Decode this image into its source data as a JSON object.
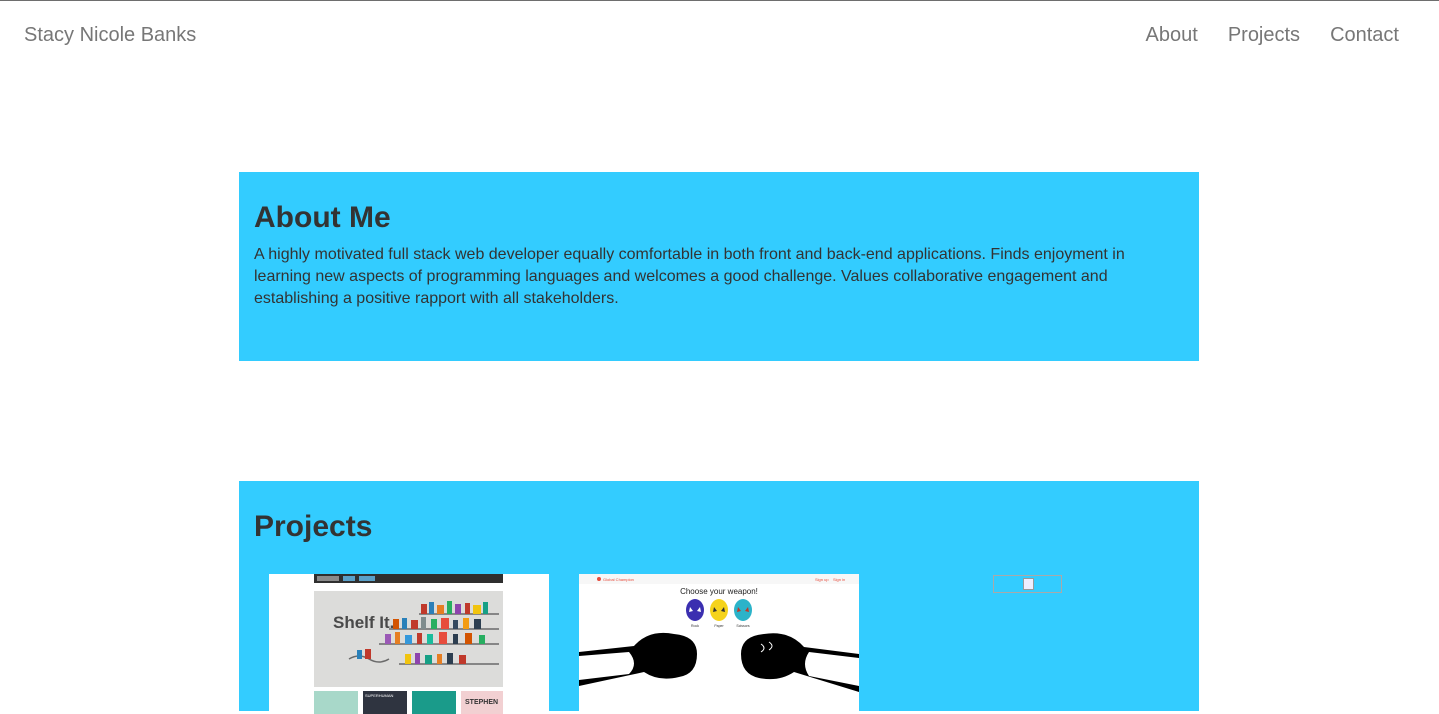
{
  "header": {
    "brand": "Stacy Nicole Banks",
    "nav": [
      {
        "label": "About"
      },
      {
        "label": "Projects"
      },
      {
        "label": "Contact"
      }
    ]
  },
  "about": {
    "title": "About Me",
    "body": "A highly motivated full stack web developer equally comfortable in both front and back-end applications. Finds enjoyment in learning new aspects of programming languages and welcomes a good challenge. Values collaborative engagement and establishing a positive rapport with all stakeholders."
  },
  "projects": {
    "title": "Projects",
    "items": [
      {
        "name": "Shelf It",
        "heading": "Shelf It.",
        "tiles": [
          "",
          "SUPERHUMAN",
          "",
          "STEPHEN"
        ]
      },
      {
        "name": "Global Champion",
        "brand": "Global Champion",
        "nav": [
          "Sign up",
          "Sign in"
        ],
        "heading": "Choose your weapon!",
        "weapons": [
          "Rock",
          "Paper",
          "Scissors"
        ]
      },
      {
        "name": "broken-image"
      }
    ]
  },
  "colors": {
    "accent": "#33ccff",
    "nav_text": "#777777",
    "body_text": "#333333"
  }
}
